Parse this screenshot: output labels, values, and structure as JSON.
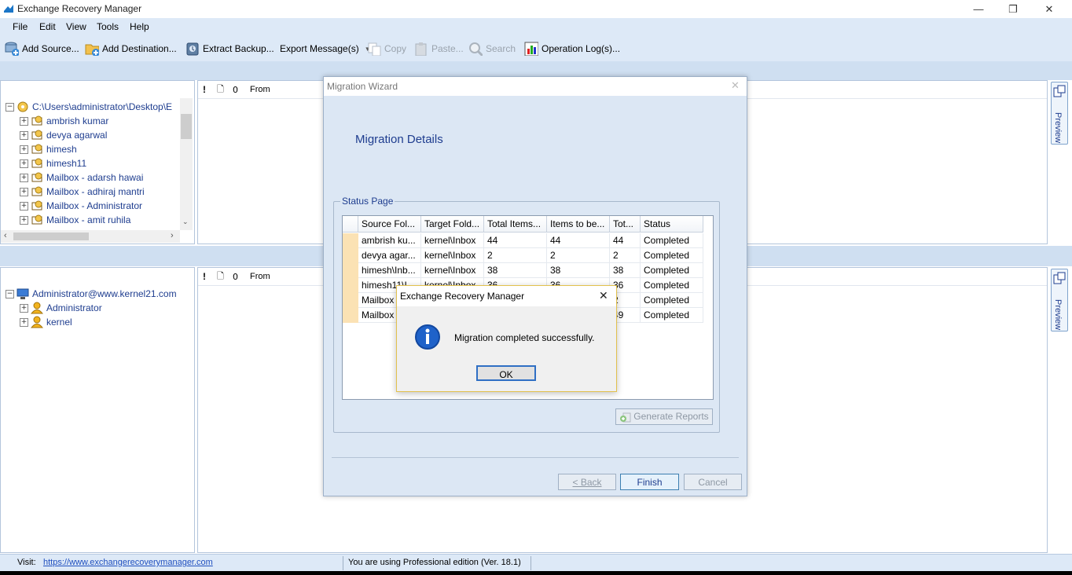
{
  "window": {
    "title": "Exchange Recovery Manager",
    "minimize": "—",
    "maximize": "❐",
    "close": "✕"
  },
  "menu": [
    "File",
    "Edit",
    "View",
    "Tools",
    "Help"
  ],
  "toolbar": {
    "add_source": "Add Source...",
    "add_destination": "Add Destination...",
    "extract_backup": "Extract Backup...",
    "export_messages": "Export Message(s)",
    "copy": "Copy",
    "paste": "Paste...",
    "search": "Search",
    "operation_logs": "Operation Log(s)..."
  },
  "source_tree": {
    "root": "C:\\Users\\administrator\\Desktop\\E",
    "items": [
      "ambrish kumar",
      "devya agarwal",
      "himesh",
      "himesh11",
      "Mailbox - adarsh hawai",
      "Mailbox - adhiraj mantri",
      "Mailbox - Administrator",
      "Mailbox - amit ruhila"
    ]
  },
  "dest_tree": {
    "root": "Administrator@www.kernel21.com",
    "items": [
      "Administrator",
      "kernel"
    ]
  },
  "message_columns": {
    "importance": "!",
    "type": "🗋",
    "attachment": "0",
    "from": "From"
  },
  "preview_label": "Preview",
  "statusbar": {
    "visit_label": "Visit:",
    "url": "https://www.exchangerecoverymanager.com",
    "edition": "You are using Professional edition (Ver. 18.1)"
  },
  "wizard": {
    "title": "Migration Wizard",
    "heading": "Migration Details",
    "group_label": "Status Page",
    "columns": [
      "Source Fol...",
      "Target Fold...",
      "Total Items...",
      "Items to be...",
      "Tot...",
      "Status"
    ],
    "rows": [
      [
        "ambrish ku...",
        "kernel\\Inbox",
        "44",
        "44",
        "44",
        "Completed"
      ],
      [
        "devya agar...",
        "kernel\\Inbox",
        "2",
        "2",
        "2",
        "Completed"
      ],
      [
        "himesh\\Inb...",
        "kernel\\Inbox",
        "38",
        "38",
        "38",
        "Completed"
      ],
      [
        "himesh11\\I...",
        "kernel\\Inbox",
        "36",
        "36",
        "36",
        "Completed"
      ],
      [
        "Mailbox -...",
        "",
        "",
        "",
        "2",
        "Completed"
      ],
      [
        "Mailbox -...",
        "",
        "",
        "",
        "49",
        "Completed"
      ]
    ],
    "generate_reports": "Generate Reports",
    "back": "< Back",
    "finish": "Finish",
    "cancel": "Cancel"
  },
  "message_box": {
    "title": "Exchange Recovery Manager",
    "text": "Migration completed successfully.",
    "ok": "OK",
    "icon": "info-icon"
  },
  "colors": {
    "accent": "#1e3d8f",
    "highlight": "#fbe2b4",
    "chrome": "#dde9f7"
  }
}
